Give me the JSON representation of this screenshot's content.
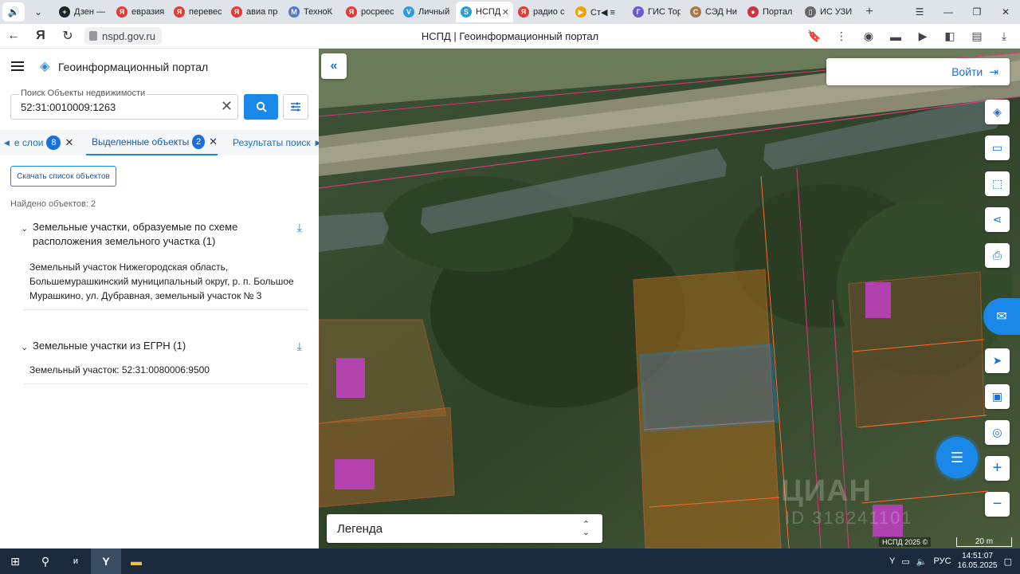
{
  "browser": {
    "tabs": [
      {
        "label": "Дзен —",
        "color": "#222222",
        "glyph": "+"
      },
      {
        "label": "евразия",
        "color": "#e53935",
        "glyph": "Я"
      },
      {
        "label": "перевес",
        "color": "#e53935",
        "glyph": "Я"
      },
      {
        "label": "авиа пр",
        "color": "#e53935",
        "glyph": "Я"
      },
      {
        "label": "ТехноК",
        "color": "#5577cc",
        "glyph": "M"
      },
      {
        "label": "росреес",
        "color": "#e53935",
        "glyph": "Я"
      },
      {
        "label": "Личный",
        "color": "#2e9be0",
        "glyph": "V"
      },
      {
        "label": "НСПД",
        "color": "#27a0d6",
        "glyph": "S",
        "active": true
      },
      {
        "label": "радио с",
        "color": "#e53935",
        "glyph": "Я"
      },
      {
        "label": "Ст◀ ≡",
        "color": "#f0a000",
        "glyph": "▶"
      },
      {
        "label": "ГИС Тор",
        "color": "#6a5acd",
        "glyph": "Г"
      },
      {
        "label": "СЭД Ни",
        "color": "#aa7744",
        "glyph": "С"
      },
      {
        "label": "Портал",
        "color": "#cc3344",
        "glyph": "●"
      },
      {
        "label": "ИС УЗИ",
        "color": "#666666",
        "glyph": "▯"
      }
    ],
    "url": "nspd.gov.ru",
    "page_title": "НСПД | Геоинформационный портал"
  },
  "panel": {
    "title": "Геоинформационный портал",
    "search": {
      "label": "Поиск Объекты недвижимости",
      "value": "52:31:0010009:1263"
    },
    "tabs": [
      {
        "label": "е слои",
        "count": "8"
      },
      {
        "label": "Выделенные объекты",
        "count": "2"
      },
      {
        "label": "Результаты поиск"
      }
    ],
    "download_list": "Скачать список объектов",
    "found": "Найдено объектов: 2",
    "groups": [
      {
        "title": "Земельные участки, образуемые по схеме расположения земельного участка (1)",
        "items": [
          "Земельный участок Нижегородская область, Большемурашкинский муниципальный округ, р. п. Большое Мурашкино, ул. Дубравная, земельный участок № 3"
        ]
      },
      {
        "title": "Земельные участки из ЕГРН (1)",
        "items": [
          "Земельный участок: 52:31:0080006:9500"
        ]
      }
    ]
  },
  "map": {
    "login": "Войти",
    "legend": "Легенда",
    "copyright": "НСПД 2025 ©",
    "scale": "20 m",
    "watermark": "ЦИАН",
    "watermark_id": "ID 318241101"
  },
  "taskbar": {
    "lang": "РУС",
    "time": "14:51:07",
    "date": "16.05.2025"
  }
}
